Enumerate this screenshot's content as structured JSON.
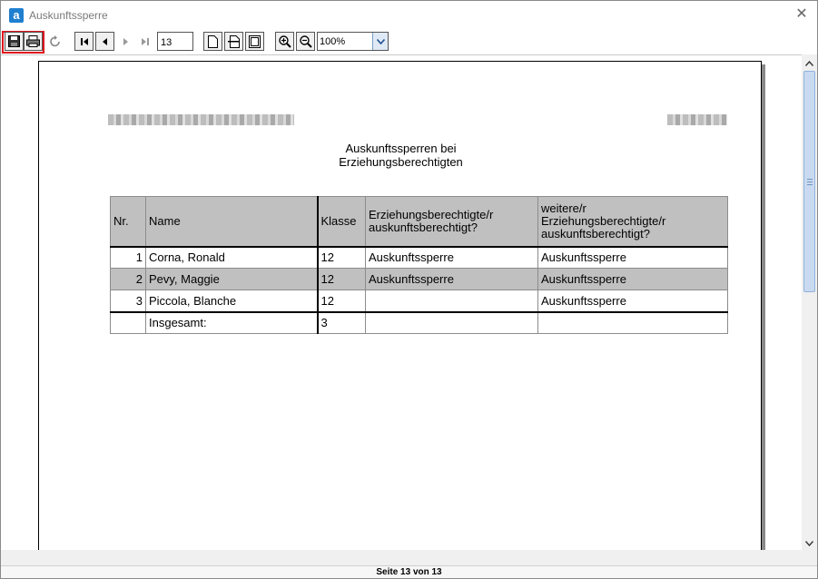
{
  "window": {
    "title": "Auskunftssperre",
    "app_icon_letter": "a",
    "close_glyph": "✕"
  },
  "toolbar": {
    "page_number": "13",
    "zoom": "100%",
    "icons": [
      "save-icon",
      "print-icon",
      "refresh-icon",
      "first-page-icon",
      "previous-page-icon",
      "next-page-icon",
      "last-page-icon",
      "single-page-icon",
      "page-width-icon",
      "whole-page-icon",
      "zoom-in-icon",
      "zoom-out-icon",
      "dropdown-arrow-icon"
    ]
  },
  "report": {
    "title_line1": "Auskunftssperren bei",
    "title_line2": "Erziehungsberechtigten",
    "columns": {
      "nr": "Nr.",
      "name": "Name",
      "klasse": "Klasse",
      "erz1_line1": "Erziehungsberechtigte/r",
      "erz1_line2": "auskunftsberechtigt?",
      "erz2_line1": "weitere/r",
      "erz2_line2": "Erziehungsberechtigte/r",
      "erz2_line3": "auskunftsberechtigt?"
    },
    "rows": [
      {
        "nr": "1",
        "name": "Corna, Ronald",
        "klasse": "12",
        "erz1": "Auskunftssperre",
        "erz2": "Auskunftssperre"
      },
      {
        "nr": "2",
        "name": "Pevy, Maggie",
        "klasse": "12",
        "erz1": "Auskunftssperre",
        "erz2": "Auskunftssperre"
      },
      {
        "nr": "3",
        "name": "Piccola, Blanche",
        "klasse": "12",
        "erz1": "",
        "erz2": "Auskunftssperre"
      }
    ],
    "total": {
      "label": "Insgesamt:",
      "value": "3"
    }
  },
  "status": {
    "text": "Seite 13 von 13"
  },
  "colors": {
    "highlight": "#e0141e",
    "table_shade": "#c0c0c0",
    "scroll_thumb": "#c9daf0"
  }
}
